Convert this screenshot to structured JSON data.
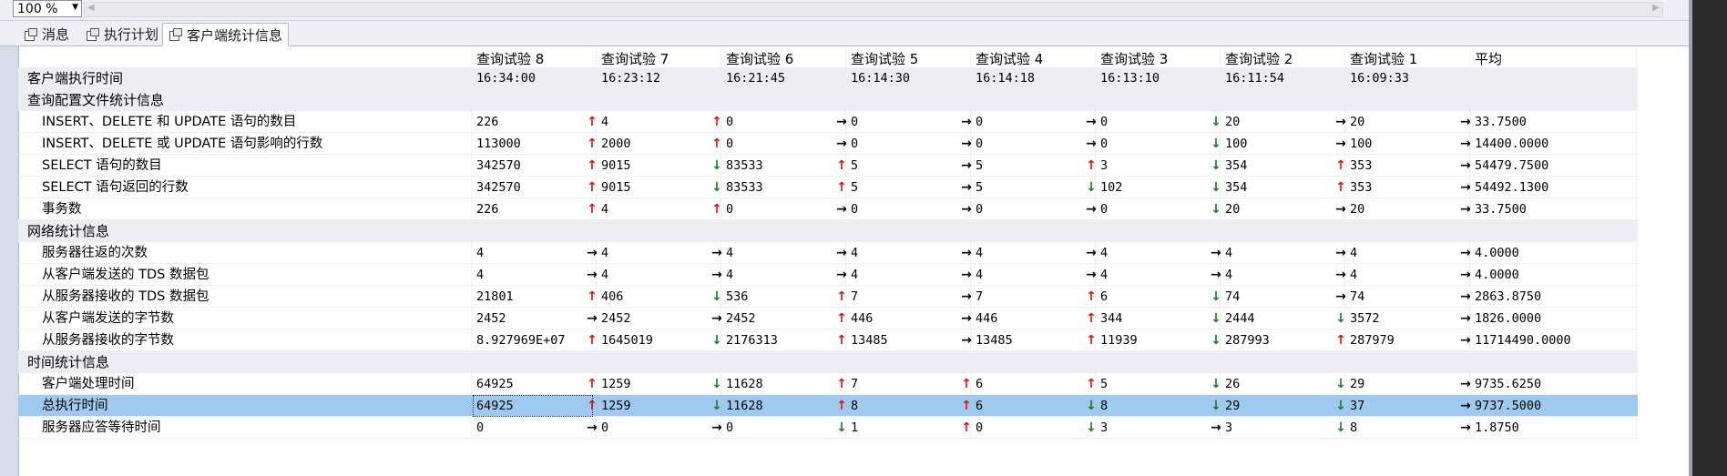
{
  "zoom": "100 %",
  "tabs": [
    {
      "label": "消息",
      "icon": "messages-icon"
    },
    {
      "label": "执行计划",
      "icon": "execution-plan-icon"
    },
    {
      "label": "客户端统计信息",
      "icon": "client-statistics-icon"
    }
  ],
  "active_tab": 2,
  "columns": [
    "查询试验 8",
    "查询试验 7",
    "查询试验 6",
    "查询试验 5",
    "查询试验 4",
    "查询试验 3",
    "查询试验 2",
    "查询试验 1",
    "平均"
  ],
  "rows": [
    {
      "type": "cat",
      "label": "客户端执行时间",
      "values": [
        "16:34:00",
        "16:23:12",
        "16:21:45",
        "16:14:30",
        "16:14:18",
        "16:13:10",
        "16:11:54",
        "16:09:33"
      ],
      "arrows": []
    },
    {
      "type": "cat",
      "label": "查询配置文件统计信息",
      "values": [],
      "arrows": []
    },
    {
      "type": "item",
      "label": "INSERT、DELETE 和 UPDATE 语句的数目",
      "values": [
        "226",
        "4",
        "0",
        "0",
        "0",
        "0",
        "20",
        "20",
        "33.7500"
      ],
      "arrows": [
        "up",
        "up",
        "right",
        "right",
        "right",
        "down",
        "right",
        "right"
      ]
    },
    {
      "type": "item",
      "label": "INSERT、DELETE 或 UPDATE 语句影响的行数",
      "values": [
        "113000",
        "2000",
        "0",
        "0",
        "0",
        "0",
        "100",
        "100",
        "14400.0000"
      ],
      "arrows": [
        "up",
        "up",
        "right",
        "right",
        "right",
        "down",
        "right",
        "right"
      ]
    },
    {
      "type": "item",
      "label": "SELECT 语句的数目",
      "values": [
        "342570",
        "9015",
        "83533",
        "5",
        "5",
        "3",
        "354",
        "353",
        "54479.7500"
      ],
      "arrows": [
        "up",
        "down",
        "up",
        "right",
        "up",
        "down",
        "up",
        "right"
      ]
    },
    {
      "type": "item",
      "label": "SELECT 语句返回的行数",
      "values": [
        "342570",
        "9015",
        "83533",
        "5",
        "5",
        "102",
        "354",
        "353",
        "54492.1300"
      ],
      "arrows": [
        "up",
        "down",
        "up",
        "right",
        "down",
        "down",
        "up",
        "right"
      ]
    },
    {
      "type": "item",
      "label": "事务数",
      "values": [
        "226",
        "4",
        "0",
        "0",
        "0",
        "0",
        "20",
        "20",
        "33.7500"
      ],
      "arrows": [
        "up",
        "up",
        "right",
        "right",
        "right",
        "down",
        "right",
        "right"
      ]
    },
    {
      "type": "cat",
      "label": "网络统计信息",
      "values": [],
      "arrows": []
    },
    {
      "type": "item",
      "label": "服务器往返的次数",
      "values": [
        "4",
        "4",
        "4",
        "4",
        "4",
        "4",
        "4",
        "4",
        "4.0000"
      ],
      "arrows": [
        "right",
        "right",
        "right",
        "right",
        "right",
        "right",
        "right",
        "right"
      ]
    },
    {
      "type": "item",
      "label": "从客户端发送的 TDS 数据包",
      "values": [
        "4",
        "4",
        "4",
        "4",
        "4",
        "4",
        "4",
        "4",
        "4.0000"
      ],
      "arrows": [
        "right",
        "right",
        "right",
        "right",
        "right",
        "right",
        "right",
        "right"
      ]
    },
    {
      "type": "item",
      "label": "从服务器接收的 TDS 数据包",
      "values": [
        "21801",
        "406",
        "536",
        "7",
        "7",
        "6",
        "74",
        "74",
        "2863.8750"
      ],
      "arrows": [
        "up",
        "down",
        "up",
        "right",
        "up",
        "down",
        "right",
        "right"
      ]
    },
    {
      "type": "item",
      "label": "从客户端发送的字节数",
      "values": [
        "2452",
        "2452",
        "2452",
        "446",
        "446",
        "344",
        "2444",
        "3572",
        "1826.0000"
      ],
      "arrows": [
        "right",
        "right",
        "up",
        "right",
        "up",
        "down",
        "down",
        "right"
      ]
    },
    {
      "type": "item",
      "label": "从服务器接收的字节数",
      "values": [
        "8.927969E+07",
        "1645019",
        "2176313",
        "13485",
        "13485",
        "11939",
        "287993",
        "287979",
        "11714490.0000"
      ],
      "arrows": [
        "up",
        "down",
        "up",
        "right",
        "up",
        "down",
        "up",
        "right"
      ]
    },
    {
      "type": "cat",
      "label": "时间统计信息",
      "values": [],
      "arrows": []
    },
    {
      "type": "item",
      "label": "客户端处理时间",
      "values": [
        "64925",
        "1259",
        "11628",
        "7",
        "6",
        "5",
        "26",
        "29",
        "9735.6250"
      ],
      "arrows": [
        "up",
        "down",
        "up",
        "up",
        "up",
        "down",
        "down",
        "right"
      ]
    },
    {
      "type": "item",
      "label": "总执行时间",
      "selected": true,
      "values": [
        "64925",
        "1259",
        "11628",
        "8",
        "6",
        "8",
        "29",
        "37",
        "9737.5000"
      ],
      "arrows": [
        "up",
        "down",
        "up",
        "up",
        "down",
        "down",
        "down",
        "right"
      ]
    },
    {
      "type": "item",
      "label": "服务器应答等待时间",
      "values": [
        "0",
        "0",
        "0",
        "1",
        "0",
        "3",
        "3",
        "8",
        "1.8750"
      ],
      "arrows": [
        "right",
        "right",
        "down",
        "up",
        "down",
        "right",
        "down",
        "right"
      ]
    }
  ]
}
